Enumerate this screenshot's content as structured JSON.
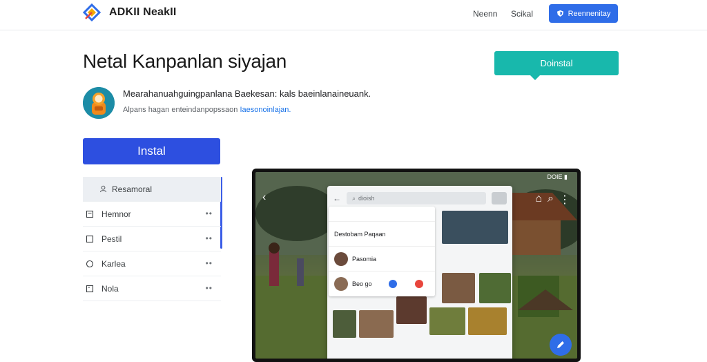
{
  "header": {
    "brand": "ADKII NeakII",
    "nav": [
      "Neenn",
      "Scikal"
    ],
    "button_label": "Reennenitay"
  },
  "hero": {
    "title": "Netal Kanpanlan siyajan",
    "tooltip": "Doinstal",
    "description": "Mearahanuahguingpanlana Baekesan: kals baeinlanaineuank.",
    "subline_text": "Alpans hagan enteindanpopssaon",
    "subline_link": "Iaesonoinlajan.",
    "install_label": "Instal"
  },
  "sidebar": {
    "items": [
      {
        "label": "Resamoral",
        "icon": "person-icon",
        "active": true
      },
      {
        "label": "Hemnor",
        "icon": "document-icon"
      },
      {
        "label": "Pestil",
        "icon": "square-icon"
      },
      {
        "label": "Karlea",
        "icon": "circle-icon"
      },
      {
        "label": "Nola",
        "icon": "note-icon"
      }
    ],
    "more_glyph": "••"
  },
  "preview": {
    "status_text": "DOIE",
    "search_text": "dioish",
    "messages": [
      {
        "title": "Destobam Paqaan"
      },
      {
        "title": "Pasomia"
      },
      {
        "title": "Beo go"
      }
    ]
  },
  "colors": {
    "primary": "#2d4fe0",
    "header_button": "#2f6de8",
    "tooltip": "#18b8ac",
    "link": "#1a73e8"
  }
}
